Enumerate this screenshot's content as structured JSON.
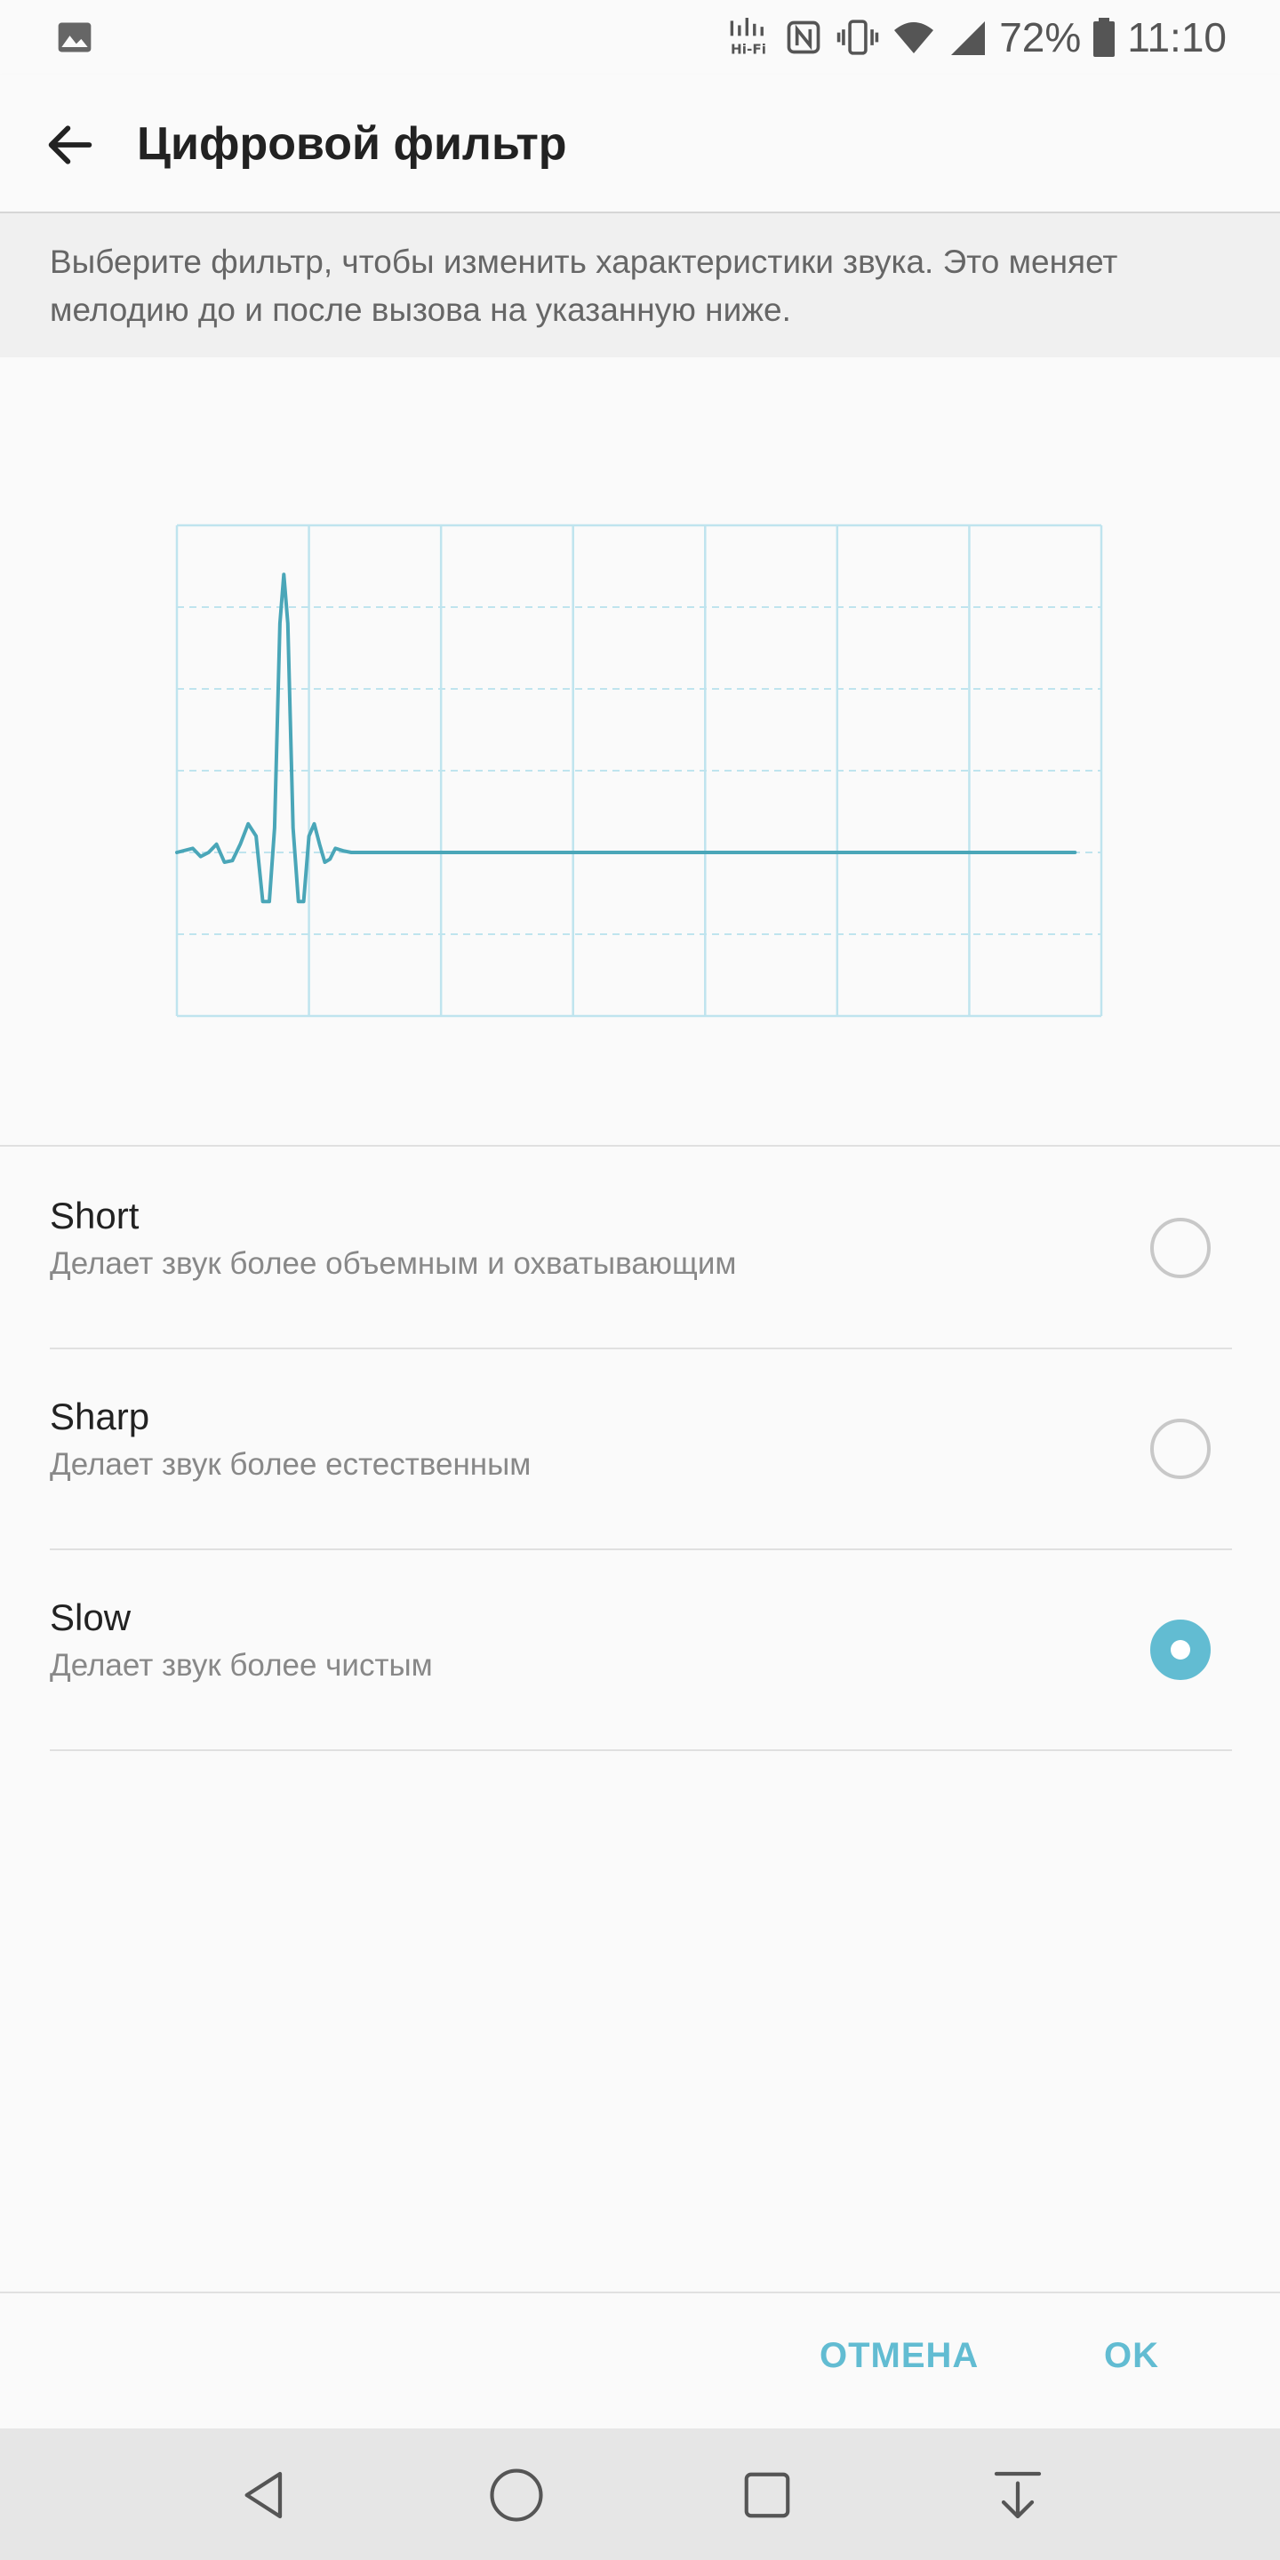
{
  "status_bar": {
    "battery_percent": "72%",
    "time": "11:10",
    "left_icon": "gallery-icon",
    "right_icons": [
      "hifi-icon",
      "nfc-icon",
      "vibrate-icon",
      "wifi-icon",
      "signal-icon",
      "battery-icon"
    ]
  },
  "app_bar": {
    "title": "Цифровой фильтр",
    "back_icon": "arrow-back-icon"
  },
  "description": "Выберите фильтр, чтобы изменить характеристики звука. Это меняет мелодию до и после вызова на указанную ниже.",
  "chart_data": {
    "type": "line",
    "title": "",
    "xlabel": "",
    "ylabel": "",
    "grid": true,
    "xlim": [
      0,
      7
    ],
    "ylim": [
      -2,
      4
    ],
    "series": [
      {
        "color": "#4aa6b8",
        "points": [
          [
            0.0,
            0.0
          ],
          [
            0.12,
            0.05
          ],
          [
            0.18,
            -0.05
          ],
          [
            0.24,
            0.0
          ],
          [
            0.3,
            0.1
          ],
          [
            0.36,
            -0.12
          ],
          [
            0.42,
            -0.1
          ],
          [
            0.48,
            0.1
          ],
          [
            0.54,
            0.35
          ],
          [
            0.6,
            0.2
          ],
          [
            0.65,
            -0.6
          ],
          [
            0.7,
            -0.6
          ],
          [
            0.74,
            0.3
          ],
          [
            0.78,
            2.8
          ],
          [
            0.81,
            3.4
          ],
          [
            0.84,
            2.8
          ],
          [
            0.88,
            0.3
          ],
          [
            0.92,
            -0.6
          ],
          [
            0.96,
            -0.6
          ],
          [
            1.0,
            0.2
          ],
          [
            1.04,
            0.35
          ],
          [
            1.08,
            0.1
          ],
          [
            1.12,
            -0.12
          ],
          [
            1.16,
            -0.08
          ],
          [
            1.2,
            0.05
          ],
          [
            1.26,
            0.02
          ],
          [
            1.32,
            0.0
          ],
          [
            6.8,
            0.0
          ]
        ]
      }
    ],
    "grid_lines": {
      "x_major": [
        0,
        1,
        2,
        3,
        4,
        5,
        6,
        7
      ],
      "y_major": [
        -2,
        4
      ],
      "y_dashed": [
        -1,
        0,
        1,
        2,
        3
      ]
    },
    "grid_color": "#bfe4ee"
  },
  "options": [
    {
      "title": "Short",
      "subtitle": "Делает звук более объемным и охватывающим",
      "selected": false
    },
    {
      "title": "Sharp",
      "subtitle": "Делает звук более естественным",
      "selected": false
    },
    {
      "title": "Slow",
      "subtitle": "Делает звук более чистым",
      "selected": true
    }
  ],
  "actions": {
    "cancel_label": "ОТМЕНА",
    "ok_label": "OK"
  },
  "nav_bar": {
    "icons": [
      "back-triangle-icon",
      "home-circle-icon",
      "recents-square-icon",
      "notification-down-icon"
    ]
  },
  "colors": {
    "accent": "#62bcd2",
    "background": "#fafafa",
    "description_bg": "#f0f0f0",
    "nav_bg": "#e6e6e6"
  }
}
